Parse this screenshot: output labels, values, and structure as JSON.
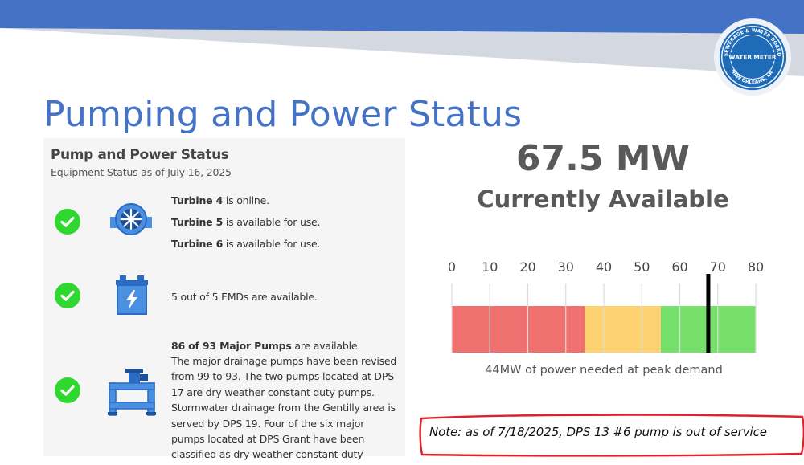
{
  "slide": {
    "title": "Pumping and Power Status"
  },
  "logo": {
    "text_top": "SEWERAGE & WATER BOARD",
    "text_center": "WATER METER",
    "text_bottom": "NEW ORLEANS, LA.",
    "icon": "sewerage-water-board-seal"
  },
  "pump_panel": {
    "title": "Pump and Power Status",
    "subtitle": "Equipment Status as of July 16, 2025",
    "turbines": {
      "icon": "turbine-icon",
      "status_icon": "check-circle-icon",
      "lines": [
        {
          "bold": "Turbine 4",
          "rest": " is online."
        },
        {
          "bold": "Turbine 5",
          "rest": " is available for use."
        },
        {
          "bold": "Turbine 6",
          "rest": " is available for use."
        }
      ]
    },
    "emds": {
      "icon": "battery-icon",
      "status_icon": "check-circle-icon",
      "text": "5 out of 5 EMDs are available."
    },
    "pumps": {
      "icon": "pipe-pump-icon",
      "status_icon": "check-circle-icon",
      "headline_bold": "86 of 93 Major Pumps",
      "headline_rest": " are available.",
      "description": "The major drainage pumps have been revised from 99 to 93. The two pumps located at DPS 17 are dry weather constant duty pumps. Stormwater drainage from the Gentilly area is served by DPS 19. Four of the six major pumps located at DPS Grant have been classified as dry weather constant duty pumps."
    }
  },
  "power": {
    "value": "67.5 MW",
    "label": "Currently Available",
    "peak_demand_note": "44MW of power needed at peak demand"
  },
  "chart_data": {
    "type": "bar",
    "title": "",
    "xlim": [
      0,
      80
    ],
    "ticks": [
      0,
      10,
      20,
      30,
      40,
      50,
      60,
      70,
      80
    ],
    "bands": [
      {
        "from": 0,
        "to": 35,
        "color": "#f07070"
      },
      {
        "from": 35,
        "to": 55,
        "color": "#fdd271"
      },
      {
        "from": 55,
        "to": 80,
        "color": "#77e06a"
      }
    ],
    "marker_value": 67.5,
    "xlabel": "44MW of power needed at peak demand"
  },
  "note": {
    "text": "Note: as of 7/18/2025, DPS 13 #6 pump is out of service"
  },
  "colors": {
    "accent_blue": "#4472c4",
    "check_green": "#2ed82e",
    "note_border": "#e0202a"
  }
}
